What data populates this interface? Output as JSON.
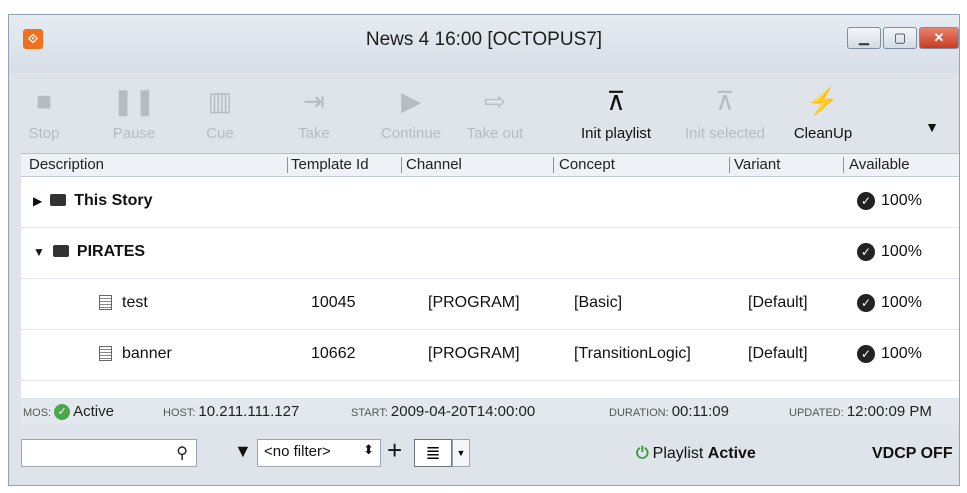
{
  "window": {
    "title": "News 4 16:00 [OCTOPUS7]",
    "app_icon": "octopus-logo-icon",
    "controls": [
      "minimize",
      "maximize",
      "close"
    ],
    "close_glyph": "✕",
    "accent": "#f07020"
  },
  "toolbar": {
    "buttons": [
      {
        "label": "Stop",
        "icon": "stop-icon",
        "enabled": false
      },
      {
        "label": "Pause",
        "icon": "pause-icon",
        "enabled": false
      },
      {
        "label": "Cue",
        "icon": "cue-icon",
        "enabled": false
      },
      {
        "label": "Take",
        "icon": "take-icon",
        "enabled": false
      },
      {
        "label": "Continue",
        "icon": "continue-icon",
        "enabled": false
      },
      {
        "label": "Take out",
        "icon": "take-out-icon",
        "enabled": false
      },
      {
        "label": "Init playlist",
        "icon": "init-playlist-icon",
        "enabled": true
      },
      {
        "label": "Init selected",
        "icon": "init-selected-icon",
        "enabled": false
      },
      {
        "label": "CleanUp",
        "icon": "cleanup-icon",
        "enabled": true
      }
    ],
    "more": "▼"
  },
  "table": {
    "columns": [
      "Description",
      "Template Id",
      "Channel",
      "Concept",
      "Variant",
      "Available"
    ],
    "rows": [
      {
        "type": "folder",
        "expanded": false,
        "description": "This Story",
        "template_id": "",
        "channel": "",
        "concept": "",
        "variant": "",
        "available": "100%"
      },
      {
        "type": "folder",
        "expanded": true,
        "description": "PIRATES",
        "template_id": "",
        "channel": "",
        "concept": "",
        "variant": "",
        "available": "100%"
      },
      {
        "type": "item",
        "description": "test",
        "template_id": "10045",
        "channel": "[PROGRAM]",
        "concept": "[Basic]",
        "variant": "[Default]",
        "available": "100%"
      },
      {
        "type": "item",
        "description": "banner",
        "template_id": "10662",
        "channel": "[PROGRAM]",
        "concept": "[TransitionLogic]",
        "variant": "[Default]",
        "available": "100%"
      }
    ]
  },
  "status": {
    "mos_key": "MOS:",
    "mos_value": "Active",
    "host_key": "HOST:",
    "host_value": "10.211.111.127",
    "start_key": "START:",
    "start_value": "2009-04-20T14:00:00",
    "duration_key": "DURATION:",
    "duration_value": "00:11:09",
    "updated_key": "UPDATED:",
    "updated_value": "12:00:09 PM",
    "active_color": "#4aa84a"
  },
  "bottom": {
    "search_value": "",
    "search_placeholder": "",
    "filter_value": "<no filter>",
    "plus": "+",
    "playlist_prefix": "Playlist",
    "playlist_state": "Active",
    "vdcp": "VDCP OFF"
  }
}
